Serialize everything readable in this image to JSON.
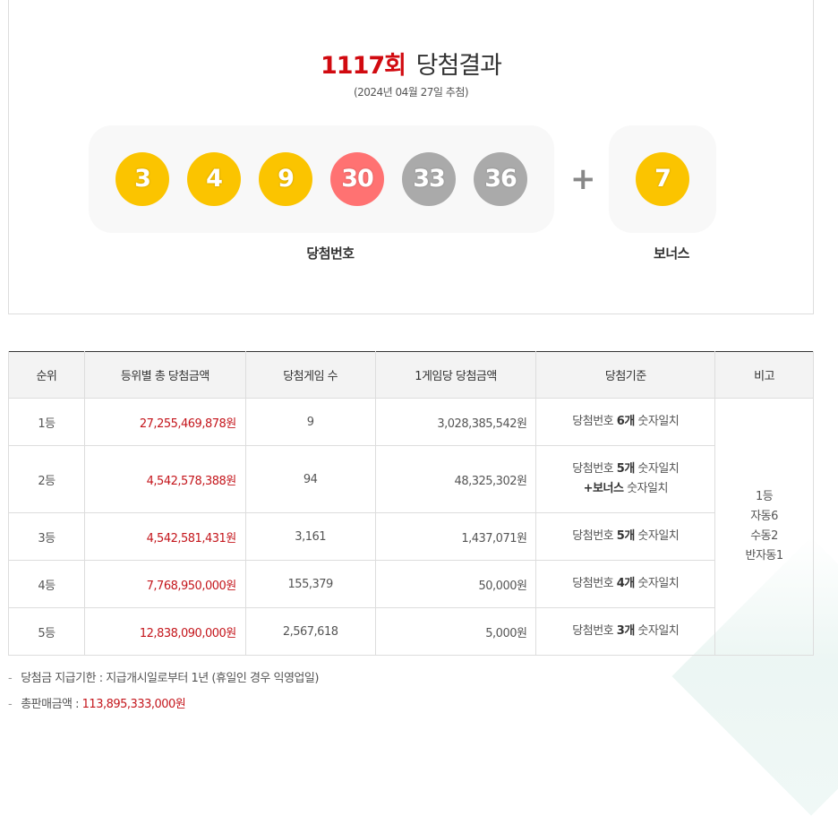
{
  "header": {
    "round": "1117회",
    "title": "당첨결과",
    "date": "(2024년 04월 27일 추첨)"
  },
  "numbers": {
    "main": [
      {
        "value": "3",
        "color": "#fbc400"
      },
      {
        "value": "4",
        "color": "#fbc400"
      },
      {
        "value": "9",
        "color": "#fbc400"
      },
      {
        "value": "30",
        "color": "#ff7272"
      },
      {
        "value": "33",
        "color": "#aaaaaa"
      },
      {
        "value": "36",
        "color": "#aaaaaa"
      }
    ],
    "plus": "+",
    "bonus": {
      "value": "7",
      "color": "#fbc400"
    },
    "main_label": "당첨번호",
    "bonus_label": "보너스"
  },
  "table": {
    "headers": [
      "순위",
      "등위별 총 당첨금액",
      "당첨게임 수",
      "1게임당 당첨금액",
      "당첨기준",
      "비고"
    ],
    "rows": [
      {
        "rank": "1등",
        "total": "27,255,469,878원",
        "games": "9",
        "per_game": "3,028,385,542원",
        "crit_pre": "당첨번호 ",
        "crit_bold": "6개",
        "crit_post": " 숫자일치"
      },
      {
        "rank": "2등",
        "total": "4,542,578,388원",
        "games": "94",
        "per_game": "48,325,302원",
        "crit_pre": "당첨번호 ",
        "crit_bold": "5개",
        "crit_post": " 숫자일치",
        "crit2_bold": "+보너스",
        "crit2_post": " 숫자일치"
      },
      {
        "rank": "3등",
        "total": "4,542,581,431원",
        "games": "3,161",
        "per_game": "1,437,071원",
        "crit_pre": "당첨번호 ",
        "crit_bold": "5개",
        "crit_post": " 숫자일치"
      },
      {
        "rank": "4등",
        "total": "7,768,950,000원",
        "games": "155,379",
        "per_game": "50,000원",
        "crit_pre": "당첨번호 ",
        "crit_bold": "4개",
        "crit_post": " 숫자일치"
      },
      {
        "rank": "5등",
        "total": "12,838,090,000원",
        "games": "2,567,618",
        "per_game": "5,000원",
        "crit_pre": "당첨번호 ",
        "crit_bold": "3개",
        "crit_post": " 숫자일치"
      }
    ],
    "remark": [
      "1등",
      "자동6",
      "수동2",
      "반자동1"
    ]
  },
  "notes": {
    "dash": "-",
    "deadline": "당첨금 지급기한 : 지급개시일로부터 1년 (휴일인 경우 익영업일)",
    "sales_label": "총판매금액 : ",
    "sales_value": "113,895,333,000원"
  },
  "colors": {
    "accent_red": "#d10a10",
    "amount_red": "#c4161c"
  }
}
